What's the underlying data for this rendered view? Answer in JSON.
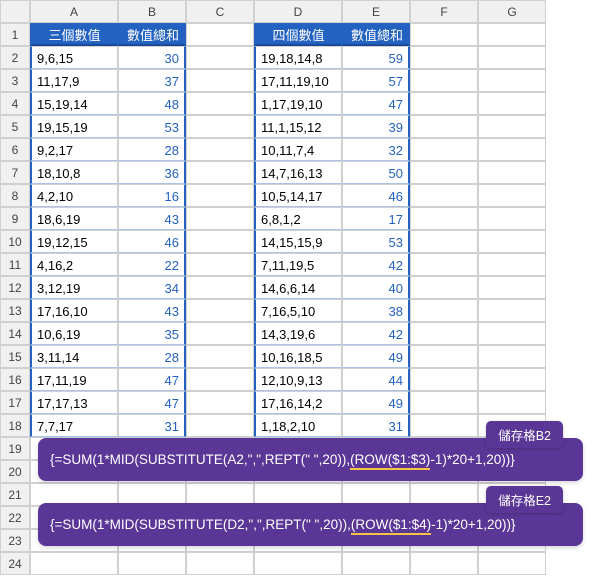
{
  "columns": [
    "A",
    "B",
    "C",
    "D",
    "E",
    "F",
    "G"
  ],
  "rowNumbers": [
    1,
    2,
    3,
    4,
    5,
    6,
    7,
    8,
    9,
    10,
    11,
    12,
    13,
    14,
    15,
    16,
    17,
    18,
    19,
    20,
    21,
    22,
    23,
    24
  ],
  "headers": {
    "A1": "三個數值",
    "B1": "數值總和",
    "D1": "四個數值",
    "E1": "數值總和"
  },
  "tableA": [
    {
      "nums": "9,6,15",
      "sum": 30
    },
    {
      "nums": "11,17,9",
      "sum": 37
    },
    {
      "nums": "15,19,14",
      "sum": 48
    },
    {
      "nums": "19,15,19",
      "sum": 53
    },
    {
      "nums": "9,2,17",
      "sum": 28
    },
    {
      "nums": "18,10,8",
      "sum": 36
    },
    {
      "nums": "4,2,10",
      "sum": 16
    },
    {
      "nums": "18,6,19",
      "sum": 43
    },
    {
      "nums": "19,12,15",
      "sum": 46
    },
    {
      "nums": "4,16,2",
      "sum": 22
    },
    {
      "nums": "3,12,19",
      "sum": 34
    },
    {
      "nums": "17,16,10",
      "sum": 43
    },
    {
      "nums": "10,6,19",
      "sum": 35
    },
    {
      "nums": "3,11,14",
      "sum": 28
    },
    {
      "nums": "17,11,19",
      "sum": 47
    },
    {
      "nums": "17,17,13",
      "sum": 47
    },
    {
      "nums": "7,7,17",
      "sum": 31
    }
  ],
  "tableD": [
    {
      "nums": "19,18,14,8",
      "sum": 59
    },
    {
      "nums": "17,11,19,10",
      "sum": 57
    },
    {
      "nums": "1,17,19,10",
      "sum": 47
    },
    {
      "nums": "11,1,15,12",
      "sum": 39
    },
    {
      "nums": "10,11,7,4",
      "sum": 32
    },
    {
      "nums": "14,7,16,13",
      "sum": 50
    },
    {
      "nums": "10,5,14,17",
      "sum": 46
    },
    {
      "nums": "6,8,1,2",
      "sum": 17
    },
    {
      "nums": "14,15,15,9",
      "sum": 53
    },
    {
      "nums": "7,11,19,5",
      "sum": 42
    },
    {
      "nums": "14,6,6,14",
      "sum": 40
    },
    {
      "nums": "7,16,5,10",
      "sum": 38
    },
    {
      "nums": "14,3,19,6",
      "sum": 42
    },
    {
      "nums": "10,16,18,5",
      "sum": 49
    },
    {
      "nums": "12,10,9,13",
      "sum": 44
    },
    {
      "nums": "17,16,14,2",
      "sum": 49
    },
    {
      "nums": "1,18,2,10",
      "sum": 31
    }
  ],
  "callouts": [
    {
      "label": "儲存格B2",
      "pre": "{=SUM(1*MID(SUBSTITUTE(A2,\",\",REPT(\" \",20)),",
      "hl": "(ROW($1:$3)",
      "post": "-1)*20+1,20))}"
    },
    {
      "label": "儲存格E2",
      "pre": "{=SUM(1*MID(SUBSTITUTE(D2,\",\",REPT(\" \",20)),",
      "hl": "(ROW($1:$4)",
      "post": "-1)*20+1,20))}"
    }
  ]
}
